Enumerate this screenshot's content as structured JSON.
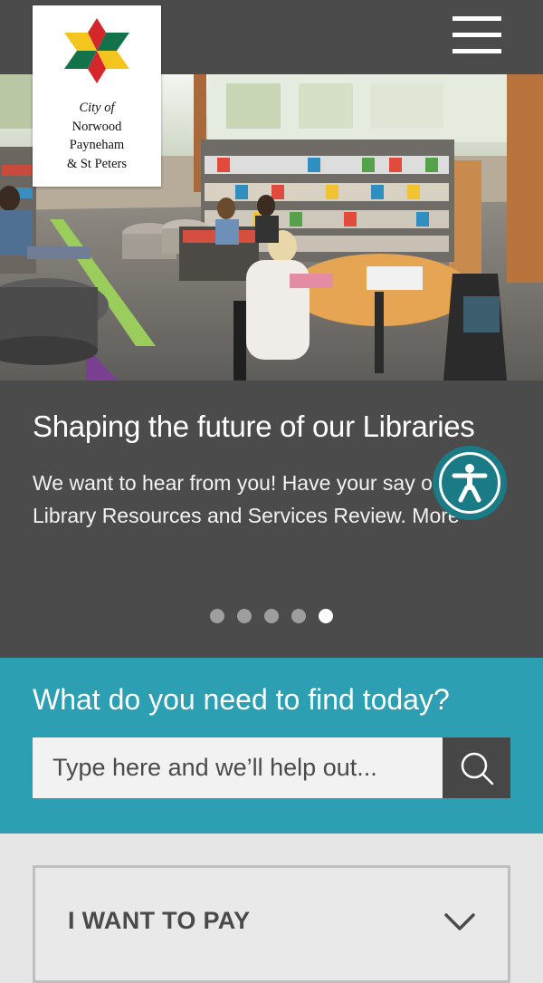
{
  "header": {
    "logo": {
      "line1": "City of",
      "line2": "Norwood",
      "line3": "Payneham",
      "line4": "& St Peters",
      "colors": [
        "#d4262b",
        "#f4c51e",
        "#14724a"
      ]
    },
    "menu_icon": "hamburger-menu-icon"
  },
  "slider": {
    "title": "Shaping the future of our Libraries",
    "text": "We want to hear from you! Have your say on the Library Resources and Services Review. More",
    "slide_count": 5,
    "active_index": 4
  },
  "accessibility": {
    "icon": "accessibility-icon"
  },
  "finder": {
    "title": "What do you need to find today?",
    "placeholder": "Type here and we’ll help out...",
    "search_icon": "search-icon"
  },
  "accordion": {
    "label": "I WANT TO PAY",
    "icon": "chevron-down-icon"
  },
  "colors": {
    "header_bg": "#4b4b4b",
    "accent_teal": "#2c9fb3",
    "accessibility_bg": "#1a7b86"
  }
}
